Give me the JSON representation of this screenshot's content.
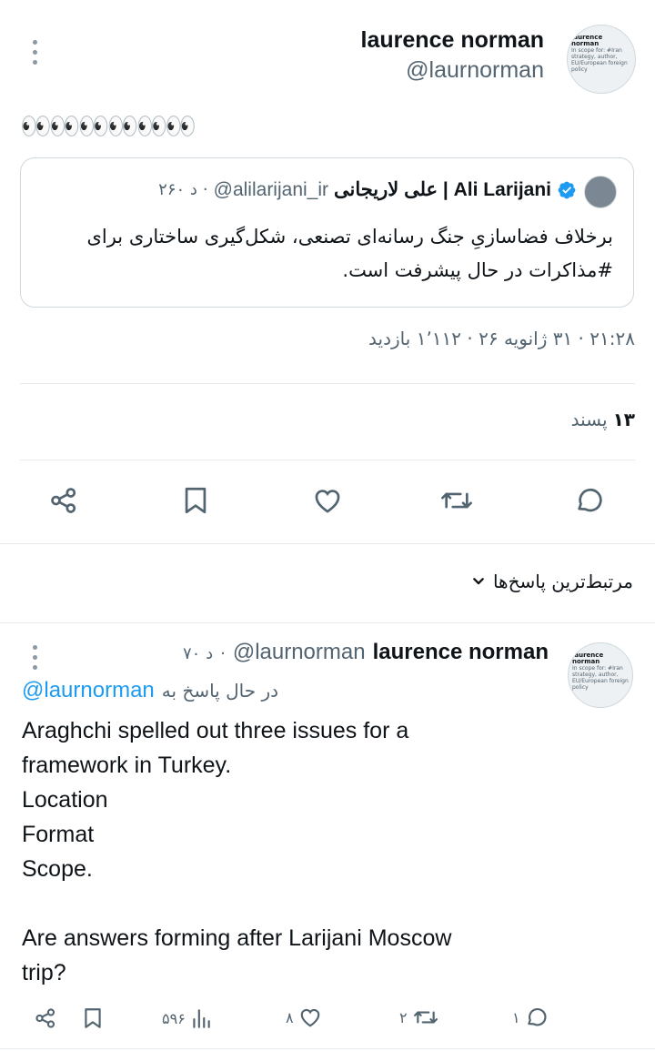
{
  "post": {
    "author_name": "laurence norman",
    "author_handle": "@laurnorman",
    "avatar_name": "laurence norman",
    "avatar_text": "In scope for: #Iran strategy, author, EU/European foreign policy",
    "text": "👀👀👀👀👀👀",
    "quoted": {
      "author_name": "علی لاریجانی | Ali Larijani",
      "author_handle": "@alilarijani_ir",
      "time": "۲۶۰ د",
      "text": "برخلاف فضاسازیِ جنگ رسانه‌ای تصنعی، شکل‌گیری ساختاری برای #مذاکرات در حال پیشرفت است."
    },
    "meta": "۲۱:۲۸ · ۳۱ ژانویه ۲۶ · ۱٬۱۱۲ بازدید",
    "likes_count": "۱۳",
    "likes_label": "پسند"
  },
  "sort": {
    "label": "مرتبط‌ترین پاسخ‌ها"
  },
  "reply": {
    "author_name": "laurence norman",
    "author_handle": "@laurnorman",
    "time": "۷۰ د",
    "replying_prefix": "در حال پاسخ به",
    "replying_handle": "@laurnorman",
    "lines": [
      "Araghchi spelled out three issues for a",
      "framework in Turkey.",
      "Location",
      "Format",
      "Scope.",
      "",
      "Are answers forming after Larijani Moscow",
      "trip?"
    ],
    "views": "۵۹۶",
    "likes": "۸",
    "reposts": "۲",
    "replies": "۱"
  },
  "colors": {
    "link": "#1d9bf0",
    "muted": "#536471",
    "divider": "#e6ecf0"
  },
  "icons": [
    "share-icon",
    "bookmark-icon",
    "heart-icon",
    "repost-icon",
    "reply-icon",
    "views-icon",
    "verified-icon",
    "more-icon",
    "chevron-down-icon"
  ]
}
